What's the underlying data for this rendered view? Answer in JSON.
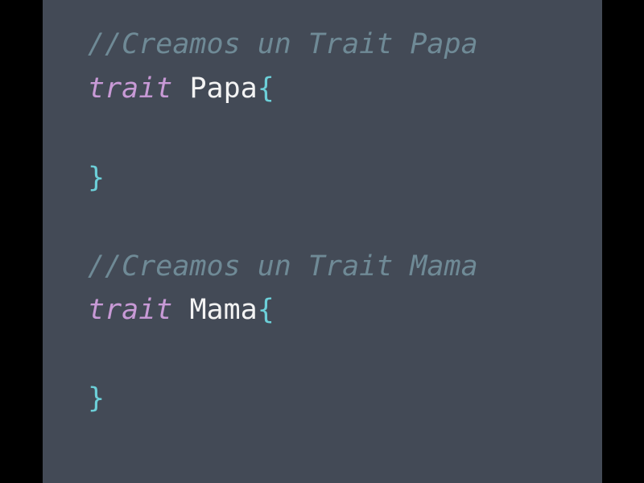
{
  "editor": {
    "lines": [
      {
        "kind": "comment",
        "text": "//Creamos un Trait Papa"
      },
      {
        "kind": "declaration",
        "keyword": "trait",
        "name": "Papa",
        "open": "{"
      },
      {
        "kind": "blank",
        "text": ""
      },
      {
        "kind": "close",
        "text": "}"
      },
      {
        "kind": "blank",
        "text": ""
      },
      {
        "kind": "comment",
        "text": "//Creamos un Trait Mama"
      },
      {
        "kind": "declaration",
        "keyword": "trait",
        "name": "Mama",
        "open": "{"
      },
      {
        "kind": "blank",
        "text": ""
      },
      {
        "kind": "close",
        "text": "}"
      }
    ],
    "colors": {
      "background": "#434a56",
      "comment": "#6f8a96",
      "keyword": "#c89ad6",
      "identifier": "#f3f3f3",
      "brace": "#6ccfd8"
    }
  }
}
